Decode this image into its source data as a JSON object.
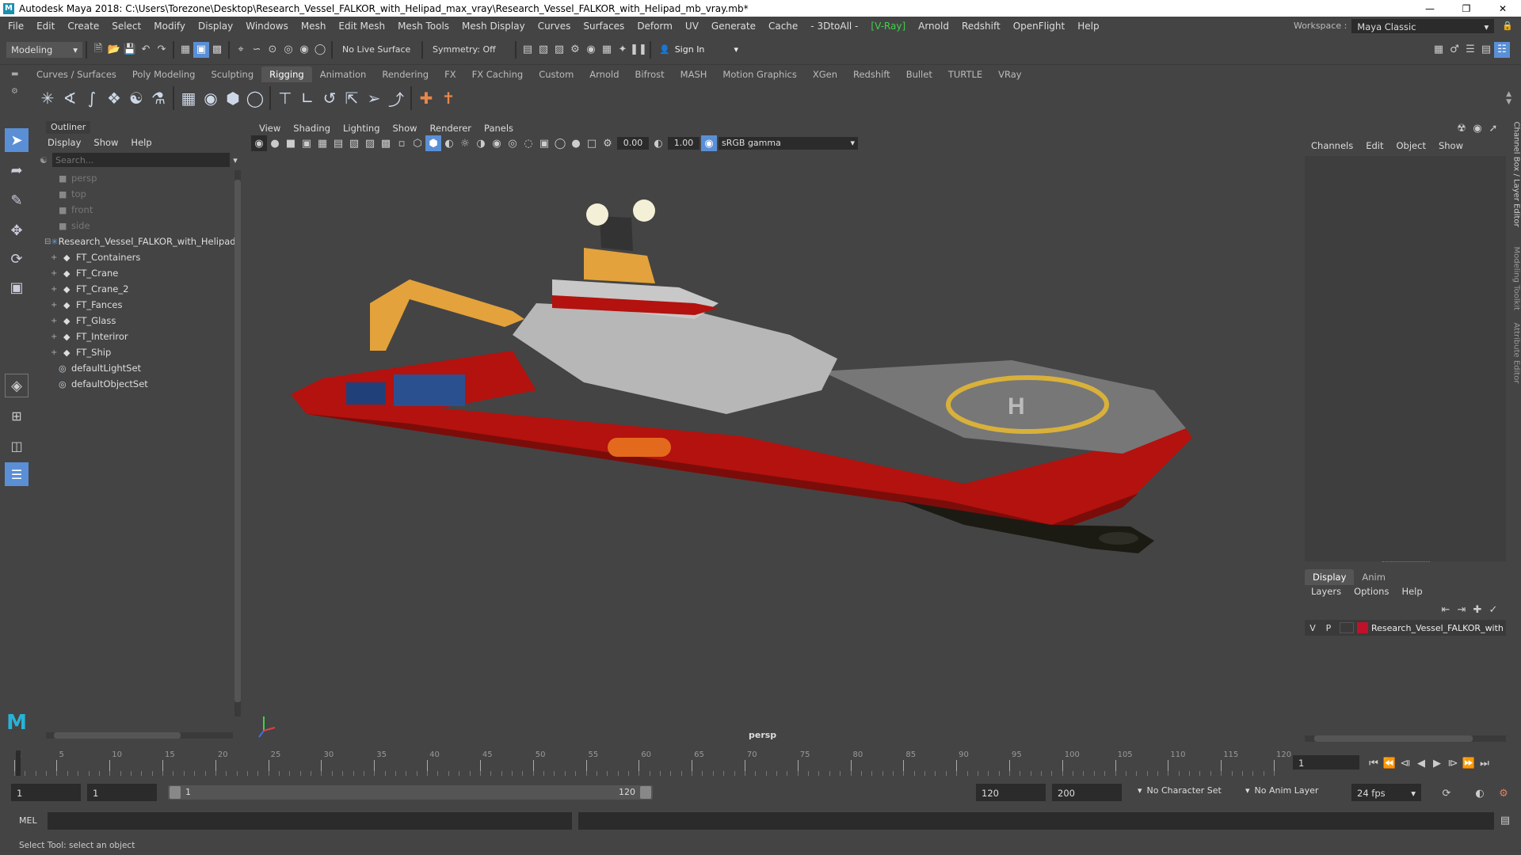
{
  "window": {
    "title": "Autodesk Maya 2018: C:\\Users\\Torezone\\Desktop\\Research_Vessel_FALKOR_with_Helipad_max_vray\\Research_Vessel_FALKOR_with_Helipad_mb_vray.mb*"
  },
  "menus": [
    "File",
    "Edit",
    "Create",
    "Select",
    "Modify",
    "Display",
    "Windows",
    "Mesh",
    "Edit Mesh",
    "Mesh Tools",
    "Mesh Display",
    "Curves",
    "Surfaces",
    "Deform",
    "UV",
    "Generate",
    "Cache",
    "- 3DtoAll -",
    "[V-Ray]",
    "Arnold",
    "Redshift",
    "OpenFlight",
    "Help"
  ],
  "workspace": {
    "label": "Workspace :",
    "value": "Maya Classic"
  },
  "statusline": {
    "mode": "Modeling",
    "live_surface": "No Live Surface",
    "symmetry": "Symmetry: Off",
    "sign_in": "Sign In"
  },
  "shelf_tabs": [
    "Curves / Surfaces",
    "Poly Modeling",
    "Sculpting",
    "Rigging",
    "Animation",
    "Rendering",
    "FX",
    "FX Caching",
    "Custom",
    "Arnold",
    "Bifrost",
    "MASH",
    "Motion Graphics",
    "XGen",
    "Redshift",
    "Bullet",
    "TURTLE",
    "VRay"
  ],
  "active_shelf_tab": "Rigging",
  "outliner": {
    "title": "Outliner",
    "menus": [
      "Display",
      "Show",
      "Help"
    ],
    "search_placeholder": "Search...",
    "items": [
      {
        "label": "persp",
        "icon": "camera-icon",
        "indent": 1,
        "dim": true
      },
      {
        "label": "top",
        "icon": "camera-icon",
        "indent": 1,
        "dim": true
      },
      {
        "label": "front",
        "icon": "camera-icon",
        "indent": 1,
        "dim": true
      },
      {
        "label": "side",
        "icon": "camera-icon",
        "indent": 1,
        "dim": true
      },
      {
        "label": "Research_Vessel_FALKOR_with_Helipad",
        "icon": "group-icon",
        "indent": 0,
        "dim": false,
        "expand": "minus"
      },
      {
        "label": "FT_Containers",
        "icon": "transform-icon",
        "indent": 2,
        "dim": false,
        "expand": "plus"
      },
      {
        "label": "FT_Crane",
        "icon": "transform-icon",
        "indent": 2,
        "dim": false,
        "expand": "plus"
      },
      {
        "label": "FT_Crane_2",
        "icon": "transform-icon",
        "indent": 2,
        "dim": false,
        "expand": "plus"
      },
      {
        "label": "FT_Fances",
        "icon": "transform-icon",
        "indent": 2,
        "dim": false,
        "expand": "plus"
      },
      {
        "label": "FT_Glass",
        "icon": "transform-icon",
        "indent": 2,
        "dim": false,
        "expand": "plus"
      },
      {
        "label": "FT_Interiror",
        "icon": "transform-icon",
        "indent": 2,
        "dim": false,
        "expand": "plus"
      },
      {
        "label": "FT_Ship",
        "icon": "transform-icon",
        "indent": 2,
        "dim": false,
        "expand": "plus"
      },
      {
        "label": "defaultLightSet",
        "icon": "set-icon",
        "indent": 1,
        "dim": false
      },
      {
        "label": "defaultObjectSet",
        "icon": "set-icon",
        "indent": 1,
        "dim": false
      }
    ]
  },
  "viewport": {
    "menus": [
      "View",
      "Shading",
      "Lighting",
      "Show",
      "Renderer",
      "Panels"
    ],
    "near": "0.00",
    "far": "1.00",
    "color_space": "sRGB gamma",
    "camera_label": "persp"
  },
  "channel_box": {
    "menus": [
      "Channels",
      "Edit",
      "Object",
      "Show"
    ],
    "side_tabs": [
      "Channel Box / Layer Editor",
      "Modeling Toolkit",
      "Attribute Editor"
    ]
  },
  "layer_editor": {
    "tabs": [
      "Display",
      "Anim"
    ],
    "active_tab": "Display",
    "menus": [
      "Layers",
      "Options",
      "Help"
    ],
    "layer": {
      "v": "V",
      "p": "P",
      "name": "Research_Vessel_FALKOR_with",
      "color": "#c0102a"
    }
  },
  "timeline": {
    "ticks": [
      "1",
      "5",
      "10",
      "15",
      "20",
      "25",
      "30",
      "35",
      "40",
      "45",
      "50",
      "55",
      "60",
      "65",
      "70",
      "75",
      "80",
      "85",
      "90",
      "95",
      "100",
      "105",
      "110",
      "115",
      "120"
    ],
    "current_frame": "1"
  },
  "range": {
    "start": "1",
    "playback_start": "1",
    "slider_start": "1",
    "slider_end": "120",
    "playback_end": "120",
    "end": "200",
    "character_set": "No Character Set",
    "anim_layer": "No Anim Layer",
    "fps": "24 fps"
  },
  "command_line": {
    "label": "MEL"
  },
  "help_line": "Select Tool: select an object",
  "colors": {
    "hull": "#b3120f",
    "accent": "#5a8fd6",
    "bg": "#444444"
  }
}
